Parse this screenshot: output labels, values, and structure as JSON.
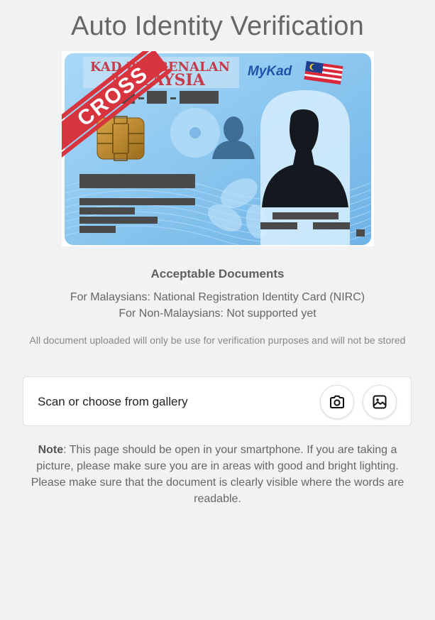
{
  "page": {
    "title": "Auto Identity Verification"
  },
  "id_card": {
    "header_text": "KAD PENGENALAN",
    "country_text": "MALAYSIA",
    "brand_text": "MyKad",
    "stamp_text": "CROSS"
  },
  "documents": {
    "heading": "Acceptable Documents",
    "malaysians_line": "For Malaysians: National Registration Identity Card (NIRC)",
    "non_malaysians_line": "For Non-Malaysians: Not supported yet",
    "disclaimer": "All document uploaded will only be use for verification purposes and will not be stored"
  },
  "upload": {
    "label": "Scan or choose from gallery",
    "camera_icon": "camera-icon",
    "gallery_icon": "image-icon"
  },
  "note": {
    "label": "Note",
    "text": ": This page should be open in your smartphone. If you are taking a picture, please make sure you are in areas with good and bright lighting. Please make sure that the document is clearly visible where the words are readable."
  },
  "colors": {
    "background": "#f2f2f2",
    "card_blue": "#8cc8f0",
    "stamp_red": "#d8343e",
    "redaction": "#4a4a4a",
    "chip_gold": "#b8862a"
  }
}
